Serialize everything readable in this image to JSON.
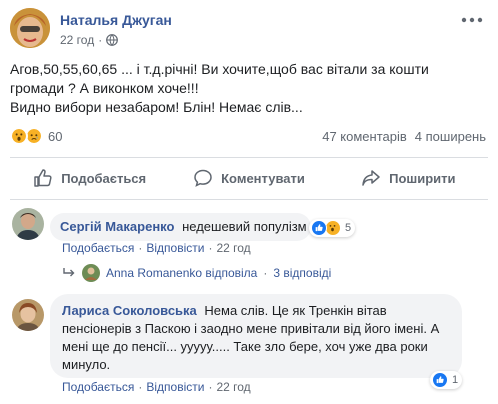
{
  "post": {
    "author": "Наталья Джуган",
    "time": "22 год",
    "separator": "·",
    "text_lines": [
      "Агов,50,55,60,65 ... і т.д.річні! Ви хочите,щоб вас вітали за кошти",
      "громади ? А виконком хоче!!!",
      "Видно вибори незабаром! Блін! Немає слів..."
    ],
    "reaction_count": "60",
    "comments_count": "47 коментарів",
    "shares_count": "4 поширень"
  },
  "actions": {
    "like": "Подобається",
    "comment": "Коментувати",
    "share": "Поширити"
  },
  "comments": [
    {
      "author": "Сергій Макаренко",
      "text": "недешевий популізм",
      "reactions": "5",
      "like_label": "Подобається",
      "reply_label": "Відповісти",
      "time": "22 год"
    },
    {
      "author": "Лариса Соколовська",
      "text": "Нема слів. Це як Тренкін вітав пенсіонерів з Паскою і заодно мене привітали від його імені. А мені ще до пенсії... ууууу..... Таке зло бере, хоч уже два роки минуло.",
      "reactions": "1",
      "like_label": "Подобається",
      "reply_label": "Відповісти",
      "time": "22 год"
    }
  ],
  "replies": {
    "name_text": "Anna Romanenko відповіла",
    "count_text": "3 відповіді"
  },
  "colors": {
    "link": "#385898",
    "like_blue": "#1877f2",
    "wow_yellow": "#f7b125",
    "muted": "#606770"
  }
}
